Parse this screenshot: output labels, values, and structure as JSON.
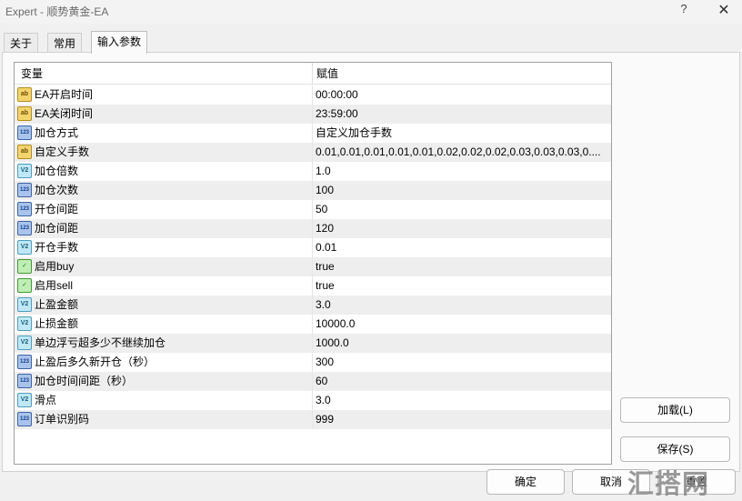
{
  "window": {
    "title": "Expert - 顺势黄金-EA",
    "help_glyph": "?",
    "close_glyph": "✕"
  },
  "tabs": [
    {
      "label": "关于",
      "active": false
    },
    {
      "label": "常用",
      "active": false
    },
    {
      "label": "输入参数",
      "active": true
    }
  ],
  "grid": {
    "headers": {
      "variable": "变量",
      "value": "赋值"
    },
    "rows": [
      {
        "icon": "string-icon",
        "icon_text": "ab",
        "name": "EA开启时间",
        "value": "00:00:00"
      },
      {
        "icon": "string-icon",
        "icon_text": "ab",
        "name": "EA关闭时间",
        "value": "23:59:00"
      },
      {
        "icon": "enum-icon",
        "icon_text": "123",
        "name": "加仓方式",
        "value": "自定义加仓手数"
      },
      {
        "icon": "string-icon",
        "icon_text": "ab",
        "name": "自定义手数",
        "value": "0.01,0.01,0.01,0.01,0.01,0.02,0.02,0.02,0.03,0.03,0.03,0...."
      },
      {
        "icon": "double-icon",
        "icon_text": "V2",
        "name": "加仓倍数",
        "value": "1.0"
      },
      {
        "icon": "integer-icon",
        "icon_text": "123",
        "name": "加仓次数",
        "value": "100"
      },
      {
        "icon": "integer-icon",
        "icon_text": "123",
        "name": "开仓间距",
        "value": "50"
      },
      {
        "icon": "integer-icon",
        "icon_text": "123",
        "name": "加仓间距",
        "value": "120"
      },
      {
        "icon": "double-icon",
        "icon_text": "V2",
        "name": "开仓手数",
        "value": "0.01"
      },
      {
        "icon": "bool-icon",
        "icon_text": "✓",
        "name": "启用buy",
        "value": "true"
      },
      {
        "icon": "bool-icon",
        "icon_text": "✓",
        "name": "启用sell",
        "value": "true"
      },
      {
        "icon": "double-icon",
        "icon_text": "V2",
        "name": "止盈金额",
        "value": "3.0"
      },
      {
        "icon": "double-icon",
        "icon_text": "V2",
        "name": "止损金额",
        "value": "10000.0"
      },
      {
        "icon": "double-icon",
        "icon_text": "V2",
        "name": "单边浮亏超多少不继续加仓",
        "value": "1000.0"
      },
      {
        "icon": "integer-icon",
        "icon_text": "123",
        "name": "止盈后多久新开仓（秒）",
        "value": "300"
      },
      {
        "icon": "integer-icon",
        "icon_text": "123",
        "name": "加仓时间间距（秒）",
        "value": "60"
      },
      {
        "icon": "double-icon",
        "icon_text": "V2",
        "name": "滑点",
        "value": "3.0"
      },
      {
        "icon": "integer-icon",
        "icon_text": "123",
        "name": "订单识别码",
        "value": "999"
      }
    ]
  },
  "side_buttons": {
    "load": "加载(L)",
    "save": "保存(S)"
  },
  "bottom_buttons": {
    "ok": "确定",
    "cancel": "取消",
    "reset": "重置"
  },
  "watermark": "汇搭网"
}
